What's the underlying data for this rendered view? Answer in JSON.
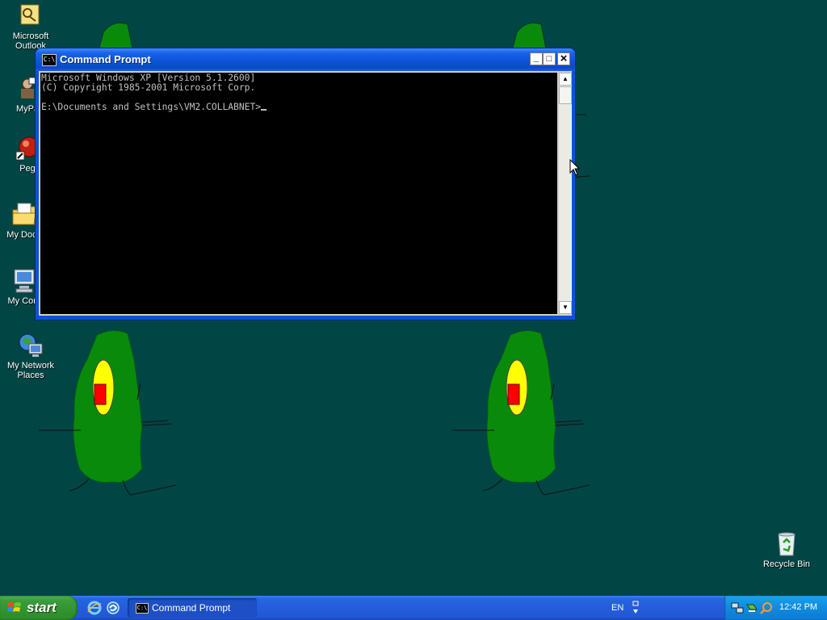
{
  "desktop": {
    "icons": [
      {
        "label": "Microsoft Outlook",
        "icon": "outlook-icon"
      },
      {
        "label": "MyPa",
        "icon": "mypal-icon"
      },
      {
        "label": "Peg",
        "icon": "pegasus-icon"
      },
      {
        "label": "My Docu",
        "icon": "my-documents-icon"
      },
      {
        "label": "My Com",
        "icon": "my-computer-icon"
      },
      {
        "label": "My Network Places",
        "icon": "network-places-icon"
      },
      {
        "label": "Recycle Bin",
        "icon": "recycle-bin-icon"
      }
    ]
  },
  "cmd_window": {
    "title": "Command Prompt",
    "minimize_glyph": "_",
    "maximize_glyph": "□",
    "close_glyph": "×",
    "icon_text": "C:\\",
    "console_lines": [
      "Microsoft Windows XP [Version 5.1.2600]",
      "(C) Copyright 1985-2001 Microsoft Corp.",
      "",
      "E:\\Documents and Settings\\VM2.COLLABNET>"
    ],
    "scroll_up_glyph": "▲",
    "scroll_down_glyph": "▼"
  },
  "taskbar": {
    "start_label": "start",
    "task_label": "Command Prompt",
    "task_icon_text": "C:\\",
    "language": "EN",
    "clock": "12:42 PM"
  },
  "colors": {
    "desktop": "#024545",
    "creature_body": "#0a8a0a",
    "creature_eye": "#ffff00",
    "creature_pupil": "#ff0000",
    "titlebar": "#0a53d8",
    "start_button": "#3a9d3a"
  }
}
